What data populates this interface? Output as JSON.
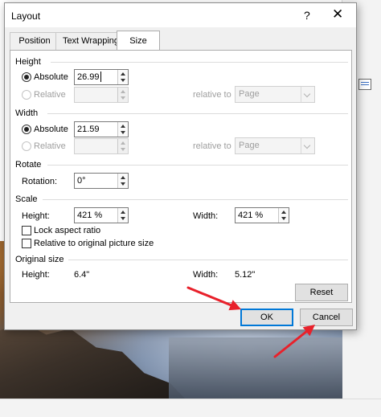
{
  "dialog": {
    "title": "Layout",
    "help_glyph": "?",
    "close_glyph": "✕",
    "tabs": [
      {
        "label": "Position",
        "active": false
      },
      {
        "label": "Text Wrapping",
        "active": false
      },
      {
        "label": "Size",
        "active": true
      }
    ]
  },
  "height": {
    "section_label": "Height",
    "absolute_label": "Absolute",
    "absolute_value": "26.99",
    "relative_label": "Relative",
    "relative_to_label": "relative to",
    "relative_to_value": "Page"
  },
  "width": {
    "section_label": "Width",
    "absolute_label": "Absolute",
    "absolute_value": "21.59",
    "relative_label": "Relative",
    "relative_to_label": "relative to",
    "relative_to_value": "Page"
  },
  "rotate": {
    "section_label": "Rotate",
    "rotation_label": "Rotation:",
    "rotation_value": "0°"
  },
  "scale": {
    "section_label": "Scale",
    "height_label": "Height:",
    "height_value": "421 %",
    "width_label": "Width:",
    "width_value": "421 %",
    "lock_aspect_label": "Lock aspect ratio",
    "relative_original_label": "Relative to original picture size"
  },
  "original_size": {
    "section_label": "Original size",
    "height_label": "Height:",
    "height_value": "6.4\"",
    "width_label": "Width:",
    "width_value": "5.12\""
  },
  "buttons": {
    "reset": "Reset",
    "ok": "OK",
    "cancel": "Cancel"
  },
  "colors": {
    "annotation_arrow": "#e8212b",
    "ok_border": "#0078d7"
  }
}
